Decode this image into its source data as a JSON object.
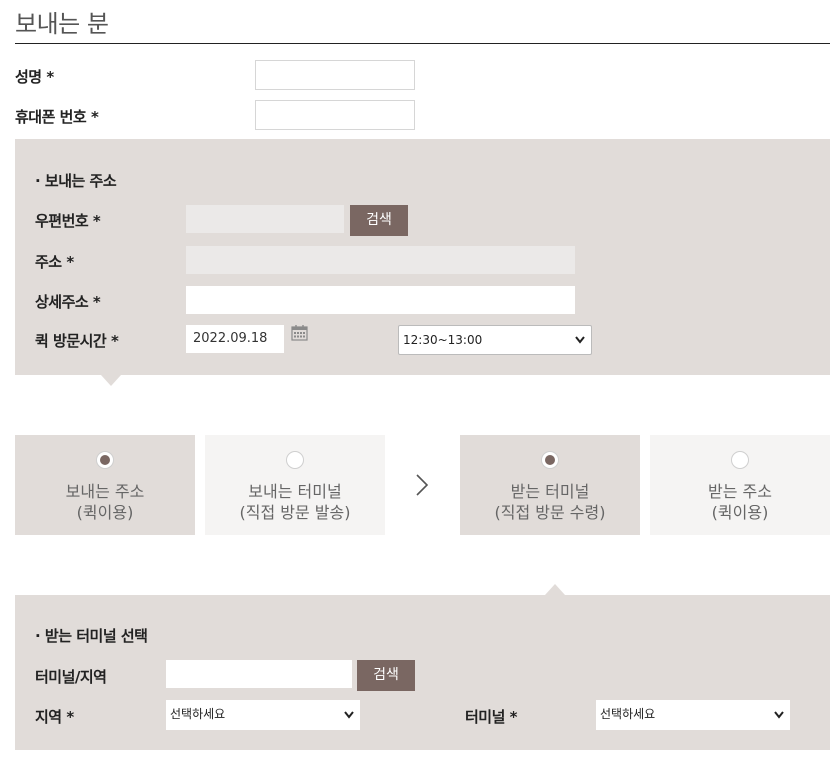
{
  "sender": {
    "title": "보내는 분",
    "name_label": "성명 *",
    "phone_label": "휴대폰 번호 *"
  },
  "send_address": {
    "heading": "· 보내는 주소",
    "zip_label": "우편번호 *",
    "search_button": "검색",
    "address_label": "주소 *",
    "detail_label": "상세주소 *",
    "visit_time_label": "퀵 방문시간 *",
    "visit_date": "2022.09.18",
    "visit_time_selected": "12:30~13:00"
  },
  "steps": [
    {
      "line1": "보내는 주소",
      "line2": "(퀵이용)",
      "selected": true
    },
    {
      "line1": "보내는 터미널",
      "line2": "(직접 방문 발송)",
      "selected": false
    },
    {
      "line1": "받는 터미널",
      "line2": "(직접 방문 수령)",
      "selected": true
    },
    {
      "line1": "받는 주소",
      "line2": "(퀵이용)",
      "selected": false
    }
  ],
  "receive_terminal": {
    "heading": "· 받는 터미널 선택",
    "terminal_region_label": "터미널/지역",
    "search_button": "검색",
    "region_label": "지역 *",
    "region_selected": "선택하세요",
    "terminal_label": "터미널 *",
    "terminal_selected": "선택하세요"
  },
  "colors": {
    "panel": "#e1dcd9",
    "button": "#7a6762",
    "step_selected_bg": "#e1dcd9",
    "step_unselected_bg": "#f5f4f3"
  }
}
